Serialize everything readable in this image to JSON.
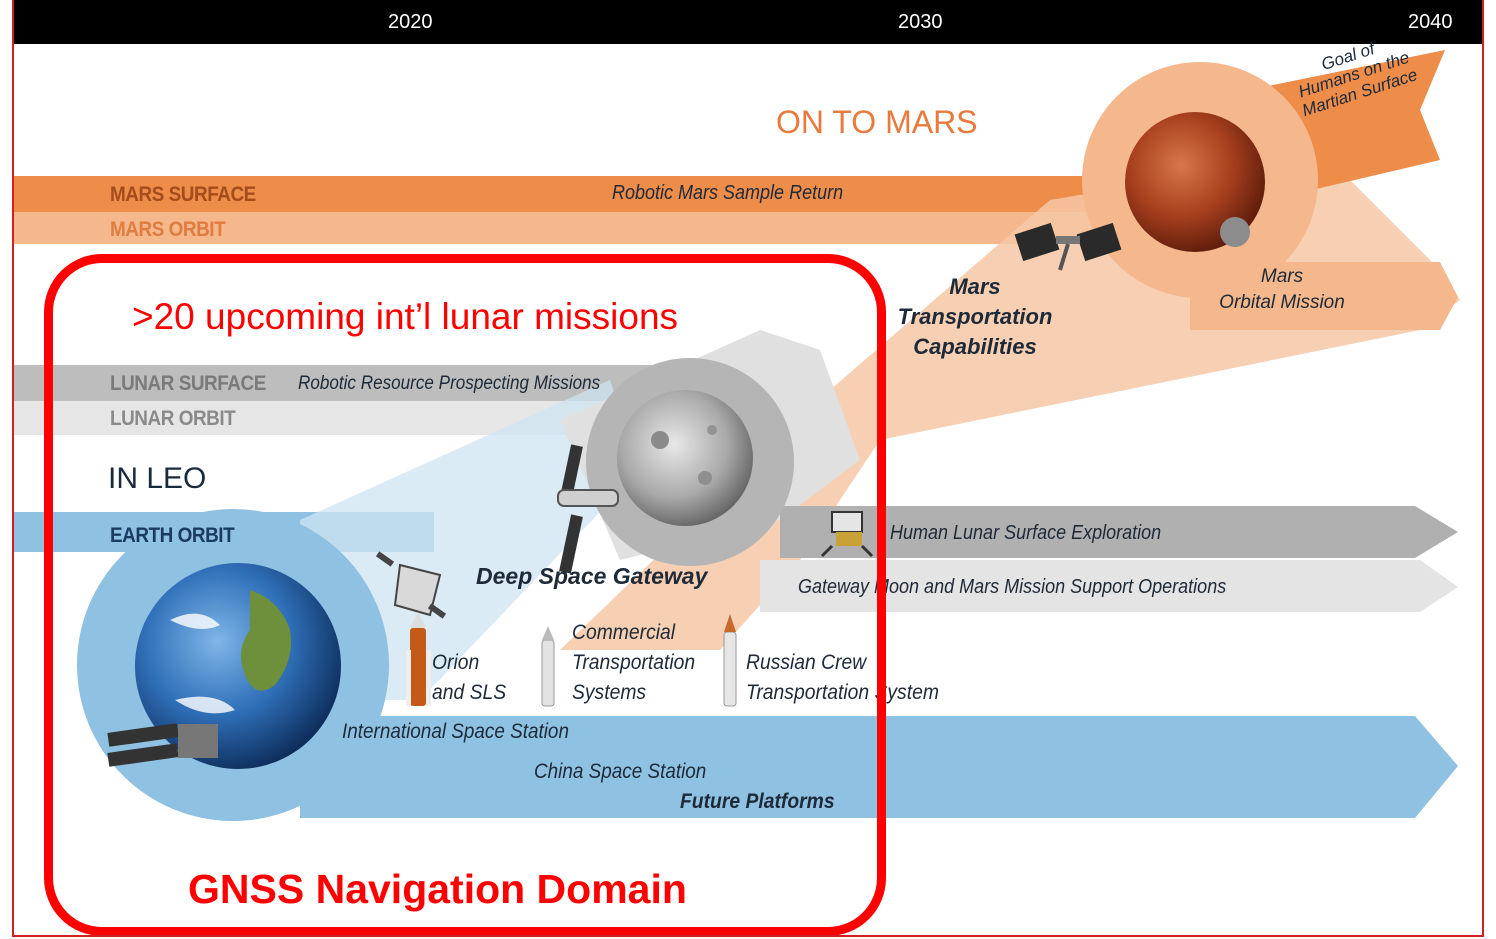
{
  "timeline": {
    "years": [
      "2020",
      "2030",
      "2040"
    ]
  },
  "mars": {
    "title": "ON TO MARS",
    "surface_band": "MARS SURFACE",
    "orbit_band": "MARS ORBIT",
    "sample_return": "Robotic Mars Sample Return",
    "goal": [
      "Goal of",
      "Humans on the",
      "Martian Surface"
    ],
    "orbital_mission": [
      "Mars",
      "Orbital Mission"
    ],
    "transport": [
      "Mars",
      "Transportation",
      "Capabilities"
    ]
  },
  "lunar": {
    "surface_band": "LUNAR SURFACE",
    "orbit_band": "LUNAR ORBIT",
    "prospecting": "Robotic Resource Prospecting Missions",
    "human_exploration": "Human Lunar Surface Exploration",
    "gateway_ops": "Gateway Moon and Mars Mission Support Operations",
    "gateway": "Deep Space Gateway"
  },
  "leo": {
    "title": "IN LEO",
    "earth_band": "EARTH ORBIT",
    "orion": [
      "Orion",
      "and SLS"
    ],
    "commercial": [
      "Commercial",
      "Transportation",
      "Systems"
    ],
    "russian": [
      "Russian Crew",
      "Transportation System"
    ],
    "iss": "International Space Station",
    "china": "China Space Station",
    "future": "Future Platforms"
  },
  "overlay": {
    "missions": ">20 upcoming int’l lunar missions",
    "domain": "GNSS Navigation Domain"
  },
  "colors": {
    "accent_red": "#ff0000",
    "mars_orange": "#ee8c4a",
    "mars_light": "#f4b88c",
    "lunar_gray": "#bdbdbd",
    "earth_blue": "#8fc1e3"
  }
}
